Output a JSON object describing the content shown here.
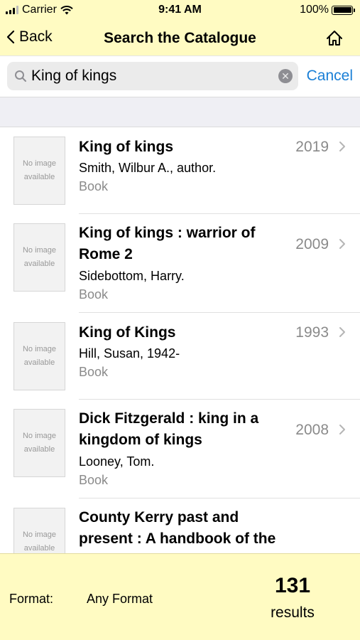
{
  "status_bar": {
    "carrier": "Carrier",
    "time": "9:41 AM",
    "battery": "100%"
  },
  "nav": {
    "back_label": "Back",
    "title": "Search the Catalogue",
    "home_icon": "home-icon"
  },
  "search": {
    "query": "King of kings",
    "cancel_label": "Cancel"
  },
  "thumbnail_text": {
    "line1": "No image",
    "line2": "available"
  },
  "results": [
    {
      "title": "King of kings",
      "author": "Smith, Wilbur A., author.",
      "format": "Book",
      "year": "2019"
    },
    {
      "title": "King of kings : warrior of Rome 2",
      "author": "Sidebottom, Harry.",
      "format": "Book",
      "year": "2009"
    },
    {
      "title": "King of Kings",
      "author": "Hill, Susan, 1942-",
      "format": "Book",
      "year": "1993"
    },
    {
      "title": "Dick Fitzgerald : king in a kingdom of kings",
      "author": "Looney, Tom.",
      "format": "Book",
      "year": "2008"
    },
    {
      "title": "County Kerry past and present : A handbook of the",
      "author": "",
      "format": "",
      "year": ""
    }
  ],
  "footer": {
    "format_label": "Format:",
    "format_value": "Any Format",
    "count": "131",
    "count_label": "results"
  },
  "colors": {
    "header_bg": "#fffbc2",
    "accent": "#1a7fd6",
    "secondary_text": "#8a8a8a"
  }
}
